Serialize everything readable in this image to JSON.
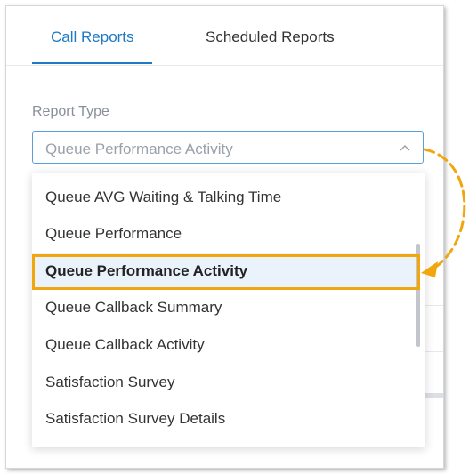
{
  "tabs": {
    "call_reports": "Call Reports",
    "scheduled_reports": "Scheduled Reports",
    "active": "call_reports"
  },
  "report_type": {
    "label": "Report Type",
    "selected_value": "Queue Performance Activity",
    "caret_icon": "chevron-up-icon"
  },
  "dropdown": {
    "options": [
      "Queue AVG Waiting & Talking Time",
      "Queue Performance",
      "Queue Performance Activity",
      "Queue Callback Summary",
      "Queue Callback Activity",
      "Satisfaction Survey",
      "Satisfaction Survey Details"
    ],
    "selected_index": 2
  },
  "colors": {
    "accent": "#1f79c4",
    "highlight": "#f1a60f",
    "selected_row": "#eaf3fb"
  }
}
